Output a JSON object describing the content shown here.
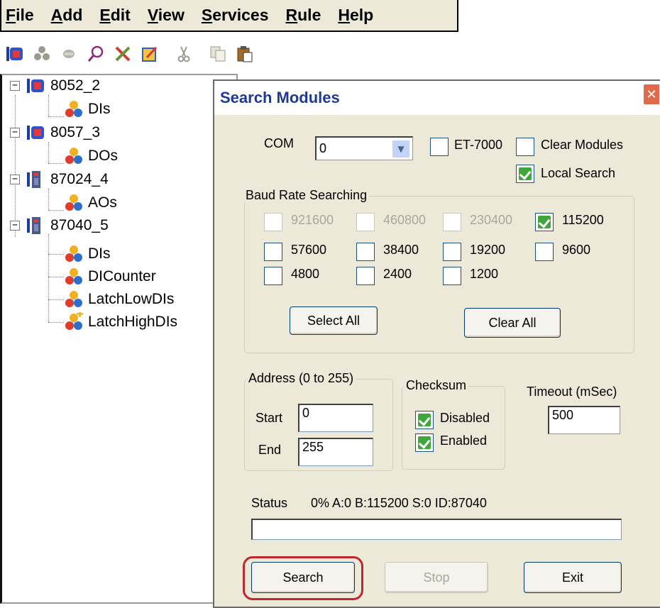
{
  "menubar": {
    "items": [
      {
        "accel": "F",
        "rest": "ile"
      },
      {
        "accel": "A",
        "rest": "dd"
      },
      {
        "accel": "E",
        "rest": "dit"
      },
      {
        "accel": "V",
        "rest": "iew"
      },
      {
        "accel": "S",
        "rest": "ervices"
      },
      {
        "accel": "R",
        "rest": "ule"
      },
      {
        "accel": "H",
        "rest": "elp"
      }
    ]
  },
  "toolbar": {
    "icons": [
      "module-icon",
      "users-icon",
      "disabled-icon",
      "search-icon",
      "tools-icon",
      "edit-icon",
      "cut-icon",
      "copy-icon",
      "paste-icon"
    ]
  },
  "tree": {
    "nodes": [
      {
        "label": "8052_2"
      },
      {
        "label": "DIs"
      },
      {
        "label": "8057_3"
      },
      {
        "label": "DOs"
      },
      {
        "label": "87024_4"
      },
      {
        "label": "AOs"
      },
      {
        "label": "87040_5"
      },
      {
        "label": "DIs"
      },
      {
        "label": "DICounter"
      },
      {
        "label": "LatchLowDIs"
      },
      {
        "label": "LatchHighDIs"
      }
    ]
  },
  "dialog": {
    "title": "Search Modules",
    "close": "✕",
    "com_label": "COM",
    "com_value": "0",
    "et7000_label": "ET-7000",
    "clear_modules_label": "Clear Modules",
    "local_search_label": "Local Search",
    "baud_group_title": "Baud Rate Searching",
    "baud_rates": [
      {
        "label": "921600",
        "checked": false,
        "enabled": false
      },
      {
        "label": "460800",
        "checked": false,
        "enabled": false
      },
      {
        "label": "230400",
        "checked": false,
        "enabled": false
      },
      {
        "label": "115200",
        "checked": true,
        "enabled": true
      },
      {
        "label": "57600",
        "checked": false,
        "enabled": true
      },
      {
        "label": "38400",
        "checked": false,
        "enabled": true
      },
      {
        "label": "19200",
        "checked": false,
        "enabled": true
      },
      {
        "label": "9600",
        "checked": false,
        "enabled": true
      },
      {
        "label": "4800",
        "checked": false,
        "enabled": true
      },
      {
        "label": "2400",
        "checked": false,
        "enabled": true
      },
      {
        "label": "1200",
        "checked": false,
        "enabled": true
      }
    ],
    "select_all": "Select All",
    "clear_all": "Clear All",
    "address_group_title": "Address (0 to 255)",
    "start_label": "Start",
    "start_value": "0",
    "end_label": "End",
    "end_value": "255",
    "checksum_group_title": "Checksum",
    "checksum_disabled_label": "Disabled",
    "checksum_enabled_label": "Enabled",
    "timeout_label": "Timeout (mSec)",
    "timeout_value": "500",
    "status_label": "Status",
    "status_text": "0% A:0 B:115200 S:0 ID:87040",
    "progress": 0,
    "search_button": "Search",
    "stop_button": "Stop",
    "exit_button": "Exit"
  }
}
